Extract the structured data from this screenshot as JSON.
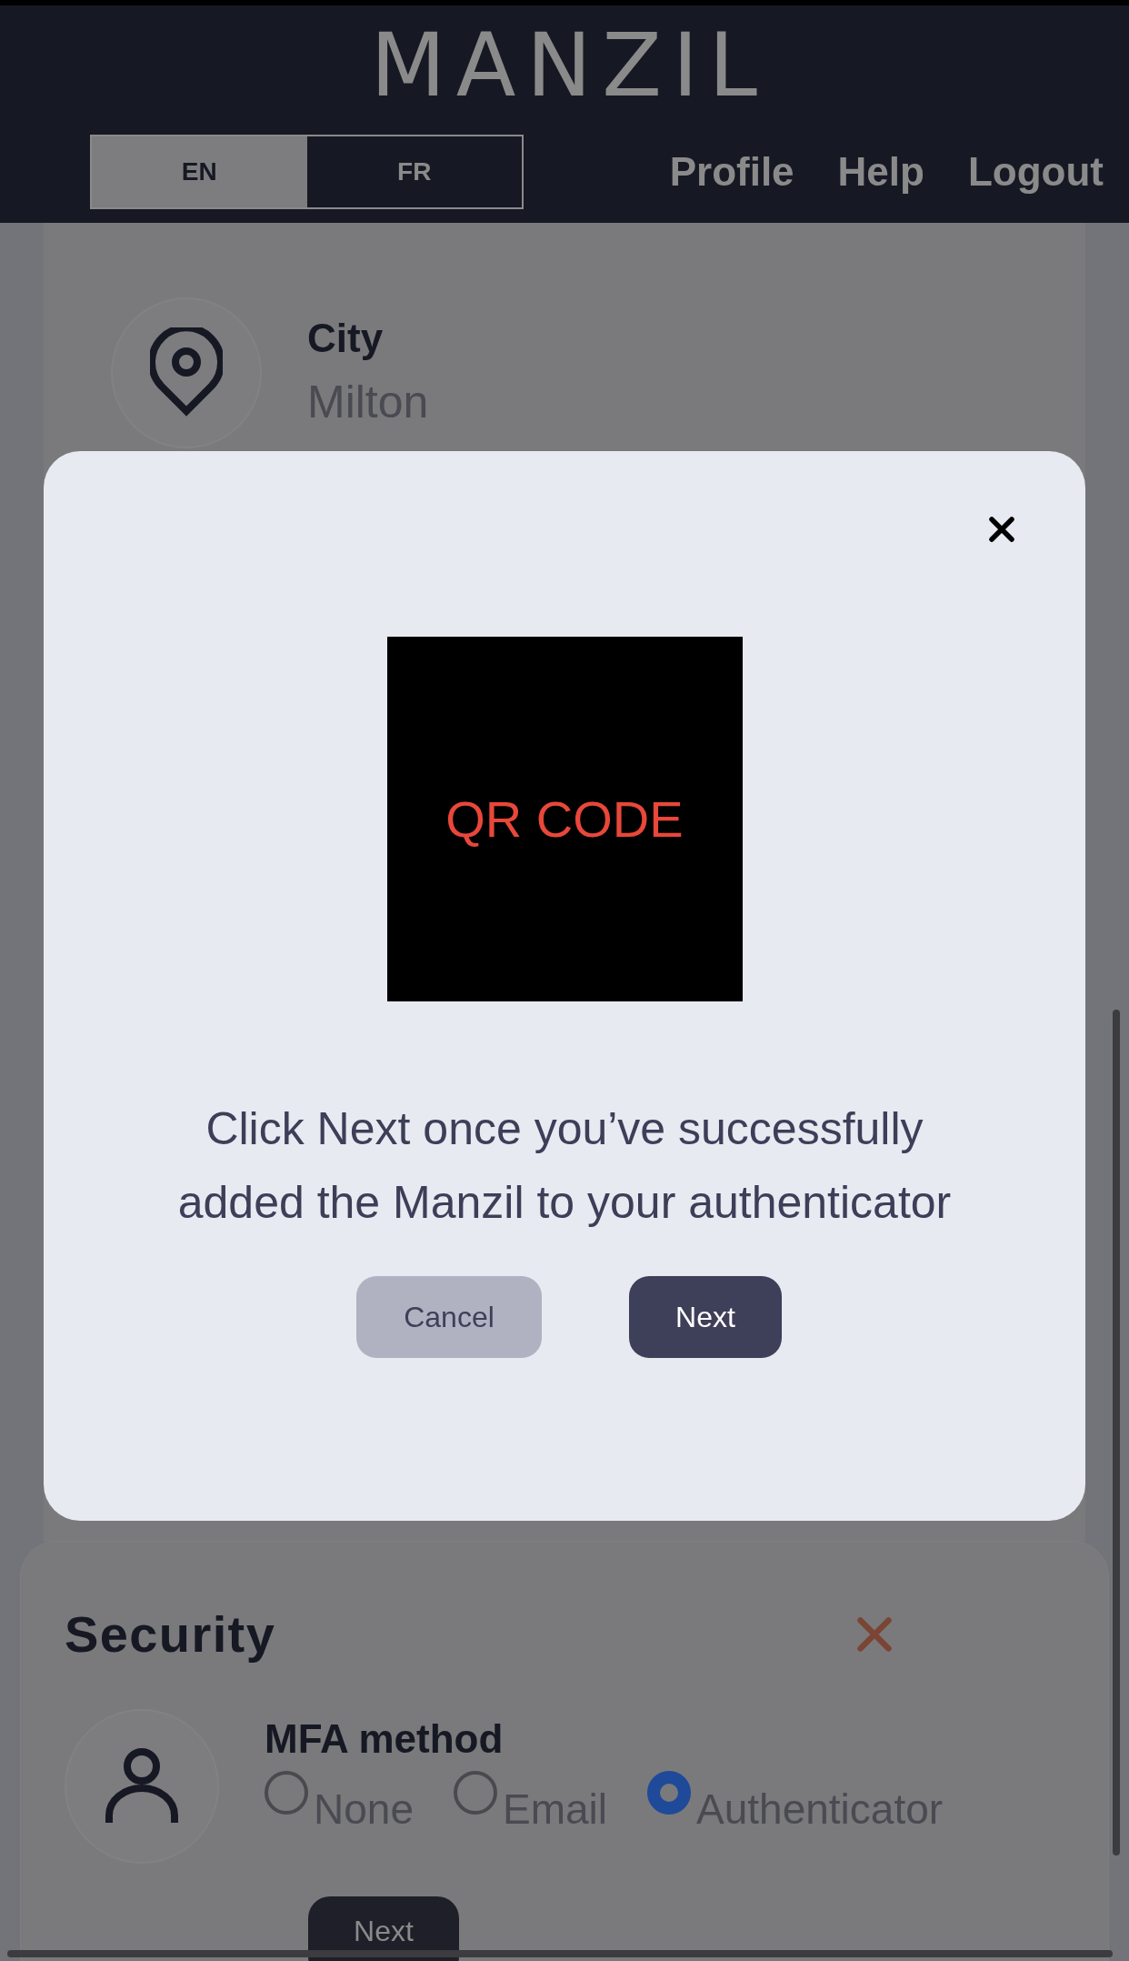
{
  "header": {
    "logo": "MANZIL",
    "languages": [
      {
        "label": "EN",
        "selected": true
      },
      {
        "label": "FR",
        "selected": false
      }
    ],
    "nav": [
      "Profile",
      "Help",
      "Logout"
    ]
  },
  "city": {
    "label": "City",
    "value": "Milton"
  },
  "modal": {
    "qr_label": "QR CODE",
    "message": "Click Next once you’ve successfully added the Manzil to your authenticator",
    "buttons": [
      {
        "label": "Cancel",
        "kind": "secondary"
      },
      {
        "label": "Next",
        "kind": "primary"
      }
    ]
  },
  "security": {
    "title": "Security",
    "mfa_label": "MFA method",
    "options": [
      {
        "label": "None",
        "selected": false
      },
      {
        "label": "Email",
        "selected": false
      },
      {
        "label": "Authenticator",
        "selected": true
      }
    ],
    "button": "Next"
  }
}
